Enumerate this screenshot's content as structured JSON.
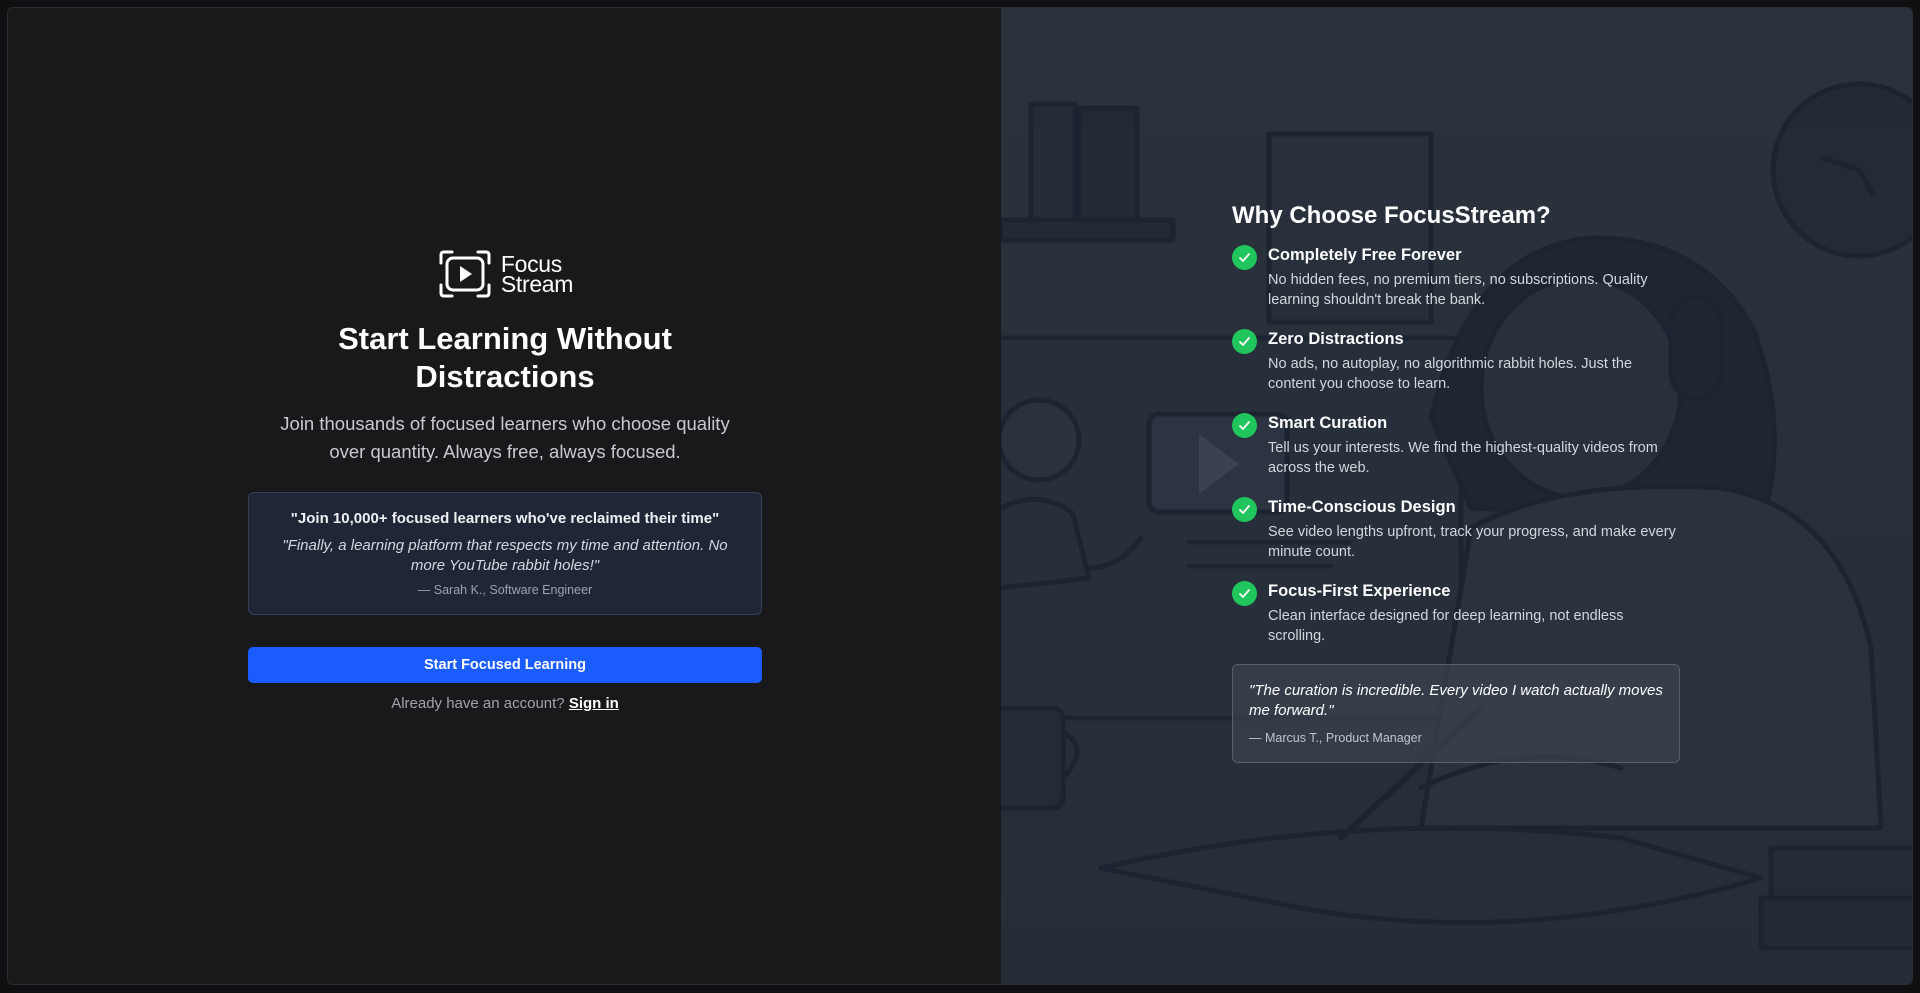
{
  "brand": {
    "name_line1": "Focus",
    "name_line2": "Stream",
    "icon": "play-frame-icon"
  },
  "signup": {
    "headline": "Start Learning Without Distractions",
    "subheadline": "Join thousands of focused learners who choose quality over quantity. Always free, always focused.",
    "quote_card": {
      "title": "\"Join 10,000+ focused learners who've reclaimed their time\"",
      "quote": "\"Finally, a learning platform that respects my time and attention. No more YouTube rabbit holes!\"",
      "author": "— Sarah K., Software Engineer"
    },
    "cta_label": "Start Focused Learning",
    "have_account_text": "Already have an account?",
    "signin_label": "Sign in"
  },
  "benefits": {
    "title": "Why Choose FocusStream?",
    "items": [
      {
        "title": "Completely Free Forever",
        "desc": "No hidden fees, no premium tiers, no subscriptions. Quality learning shouldn't break the bank.",
        "icon": "check-circle-icon"
      },
      {
        "title": "Zero Distractions",
        "desc": "No ads, no autoplay, no algorithmic rabbit holes. Just the content you choose to learn.",
        "icon": "check-circle-icon"
      },
      {
        "title": "Smart Curation",
        "desc": "Tell us your interests. We find the highest-quality videos from across the web.",
        "icon": "check-circle-icon"
      },
      {
        "title": "Time-Conscious Design",
        "desc": "See video lengths upfront, track your progress, and make every minute count.",
        "icon": "check-circle-icon"
      },
      {
        "title": "Focus-First Experience",
        "desc": "Clean interface designed for deep learning, not endless scrolling.",
        "icon": "check-circle-icon"
      }
    ],
    "testimonial": {
      "quote": "\"The curation is incredible. Every video I watch actually moves me forward.\"",
      "author": "— Marcus T., Product Manager"
    }
  },
  "colors": {
    "accent": "#1a5cff",
    "check": "#21c55d",
    "left_bg": "#19191b",
    "right_bg": "#2a323c"
  }
}
